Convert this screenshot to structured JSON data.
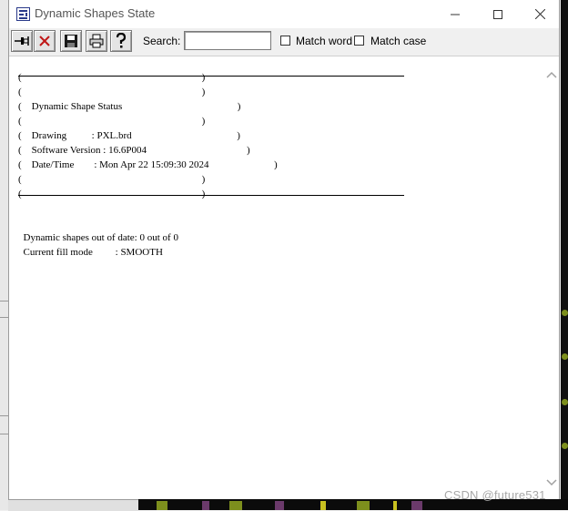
{
  "window": {
    "title": "Dynamic Shapes State",
    "controls": {
      "minimize": "—",
      "maximize": "☐",
      "close": "✕"
    }
  },
  "toolbar": {
    "buttons": [
      {
        "name": "pin",
        "icon": "pin-icon"
      },
      {
        "name": "close",
        "icon": "close-x-icon"
      },
      {
        "name": "save",
        "icon": "save-icon"
      },
      {
        "name": "print",
        "icon": "print-icon"
      },
      {
        "name": "help",
        "icon": "help-icon"
      }
    ],
    "search_label": "Search:",
    "search_value": "",
    "match_word_label": "Match word",
    "match_word_checked": false,
    "match_case_label": "Match case",
    "match_case_checked": false
  },
  "report": {
    "header_title": "Dynamic Shape Status",
    "drawing_label": "Drawing",
    "drawing_value": "PXL.brd",
    "software_label": "Software Version",
    "software_value": "16.6P004",
    "datetime_label": "Date/Time",
    "datetime_value": "Mon Apr 22 15:09:30 2024",
    "out_of_date_label": "Dynamic shapes out of date:",
    "out_of_date_value": "0 out of 0",
    "fill_mode_label": "Current fill mode",
    "fill_mode_value": "SMOOTH"
  },
  "watermark": "CSDN @future531",
  "colors": {
    "accent": "#2a3a8a",
    "pcb_bg": "#0b0b0b",
    "pcb_pad": "#7d8f1d"
  }
}
